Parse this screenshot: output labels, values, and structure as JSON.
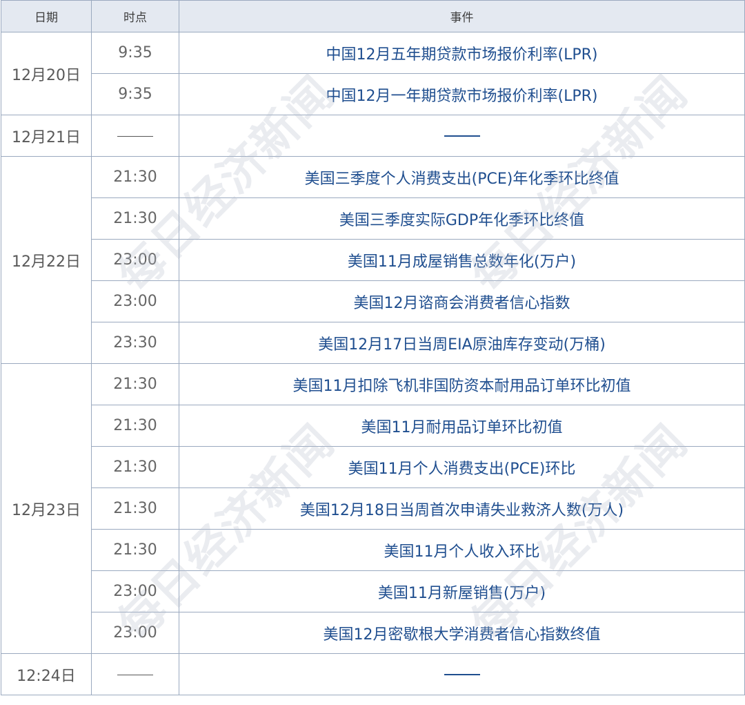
{
  "headers": {
    "date": "日期",
    "time": "时点",
    "event": "事件"
  },
  "watermark": "每日经济新闻",
  "rows": [
    {
      "date": "12月20日",
      "span": 2,
      "time": "9:35",
      "event": "中国12月五年期贷款市场报价利率(LPR)"
    },
    {
      "time": "9:35",
      "event": "中国12月一年期贷款市场报价利率(LPR)"
    },
    {
      "date": "12月21日",
      "span": 1,
      "time": "",
      "event": "",
      "dash": true
    },
    {
      "date": "12月22日",
      "span": 5,
      "time": "21:30",
      "event": "美国三季度个人消费支出(PCE)年化季环比终值"
    },
    {
      "time": "21:30",
      "event": "美国三季度实际GDP年化季环比终值"
    },
    {
      "time": "23:00",
      "event": "美国11月成屋销售总数年化(万户)"
    },
    {
      "time": "23:00",
      "event": "美国12月谘商会消费者信心指数"
    },
    {
      "time": "23:30",
      "event": "美国12月17日当周EIA原油库存变动(万桶)"
    },
    {
      "date": "12月23日",
      "span": 7,
      "time": "21:30",
      "event": "美国11月扣除飞机非国防资本耐用品订单环比初值"
    },
    {
      "time": "21:30",
      "event": "美国11月耐用品订单环比初值"
    },
    {
      "time": "21:30",
      "event": "美国11月个人消费支出(PCE)环比"
    },
    {
      "time": "21:30",
      "event": "美国12月18日当周首次申请失业救济人数(万人)"
    },
    {
      "time": "21:30",
      "event": "美国11月个人收入环比"
    },
    {
      "time": "23:00",
      "event": "美国11月新屋销售(万户)"
    },
    {
      "time": "23:00",
      "event": "美国12月密歇根大学消费者信心指数终值"
    },
    {
      "date": "12:24日",
      "span": 1,
      "time": "",
      "event": "",
      "dash": true
    }
  ]
}
